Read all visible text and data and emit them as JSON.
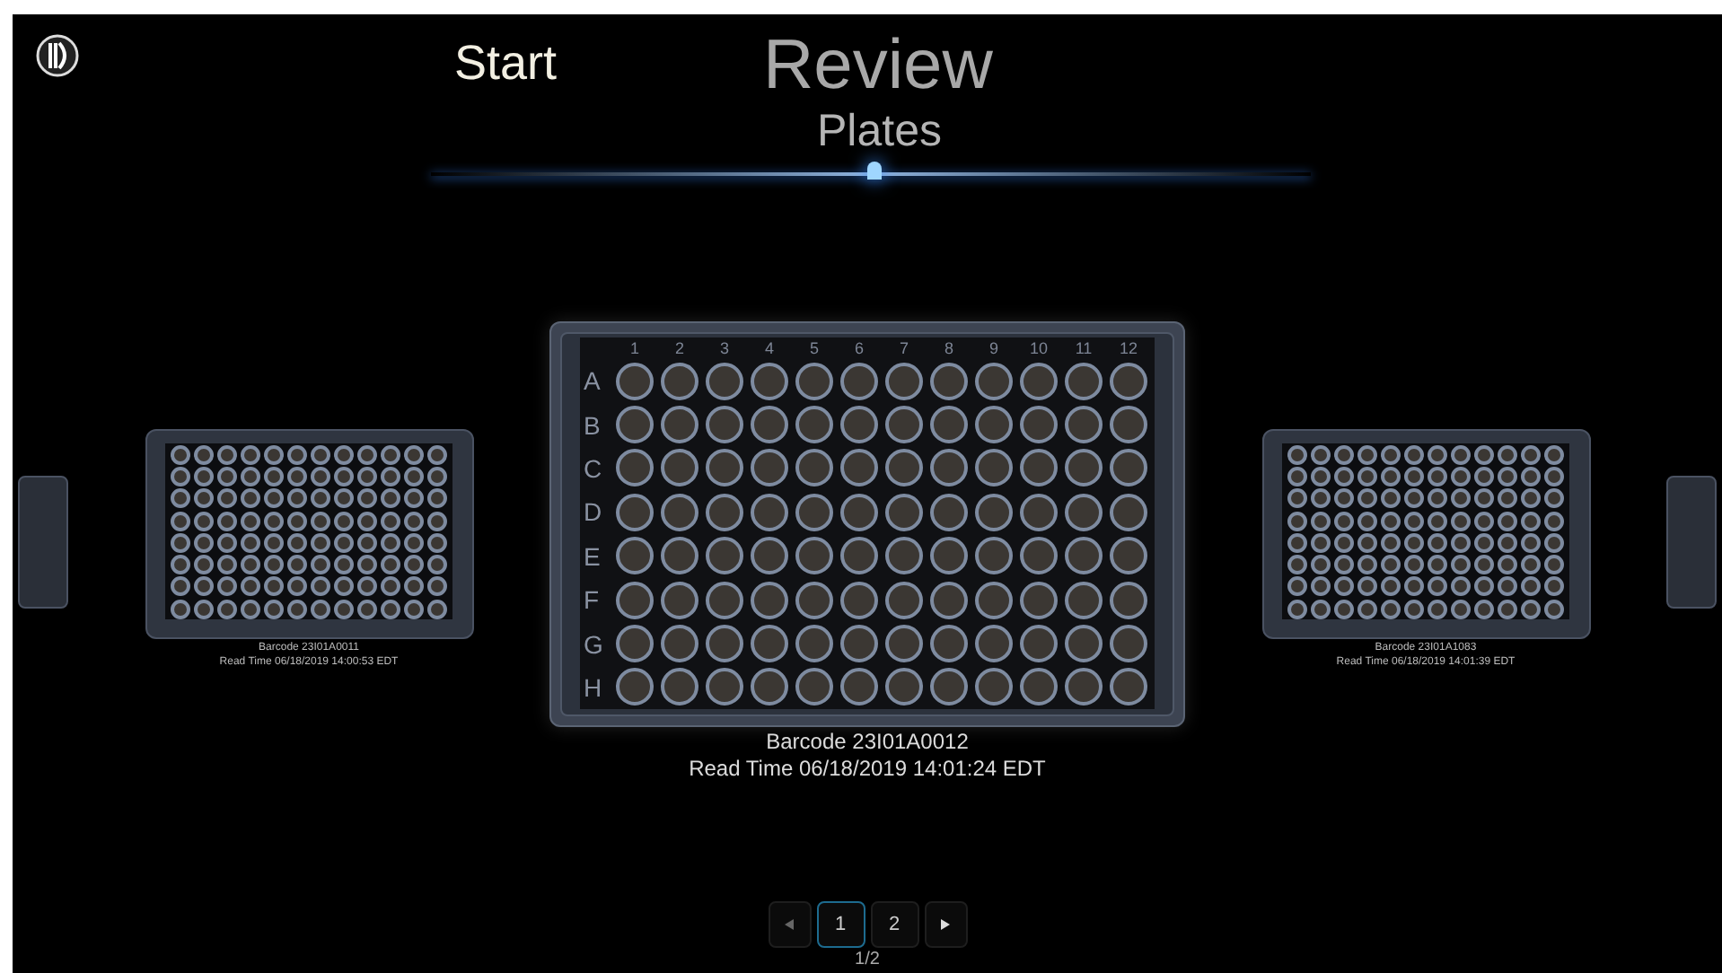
{
  "header": {
    "start": "Start",
    "title": "Review",
    "subtitle": "Plates"
  },
  "plate_grid": {
    "columns": [
      "1",
      "2",
      "3",
      "4",
      "5",
      "6",
      "7",
      "8",
      "9",
      "10",
      "11",
      "12"
    ],
    "rows": [
      "A",
      "B",
      "C",
      "D",
      "E",
      "F",
      "G",
      "H"
    ]
  },
  "plates": [
    {
      "kind": "partial"
    },
    {
      "kind": "side",
      "barcode": "Barcode 23I01A0011",
      "read_time": "Read Time 06/18/2019 14:00:53 EDT"
    },
    {
      "kind": "center",
      "barcode": "Barcode 23I01A0012",
      "read_time": "Read Time 06/18/2019 14:01:24 EDT"
    },
    {
      "kind": "side",
      "barcode": "Barcode 23I01A1083",
      "read_time": "Read Time 06/18/2019 14:01:39 EDT"
    },
    {
      "kind": "partial"
    }
  ],
  "pagination": {
    "pages": [
      {
        "label": "1",
        "selected": true
      },
      {
        "label": "2",
        "selected": false
      }
    ],
    "status": "1/2"
  }
}
